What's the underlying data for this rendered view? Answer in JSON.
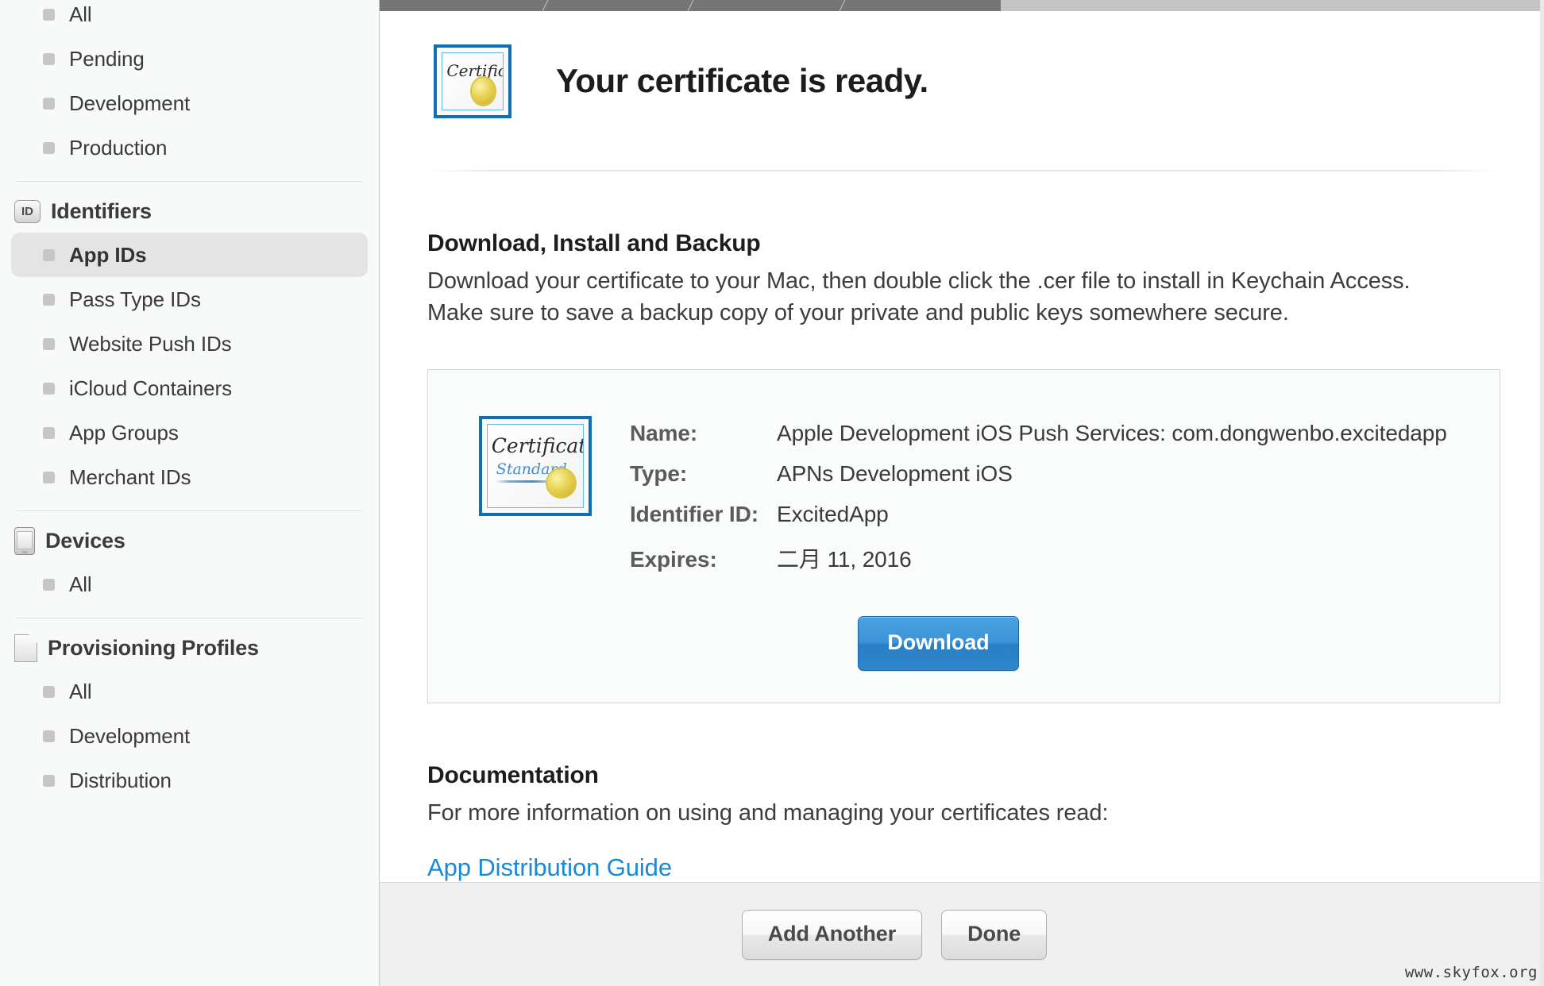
{
  "progress": {
    "completed_segments": 4,
    "track_color": "#c4c4c4",
    "done_color": "#757575"
  },
  "sidebar": {
    "groups": [
      {
        "header": null,
        "header_icon": null,
        "items": [
          {
            "label": "All",
            "selected": false
          },
          {
            "label": "Pending",
            "selected": false
          },
          {
            "label": "Development",
            "selected": false
          },
          {
            "label": "Production",
            "selected": false
          }
        ]
      },
      {
        "header": "Identifiers",
        "header_icon": "id-badge-icon",
        "header_icon_text": "ID",
        "items": [
          {
            "label": "App IDs",
            "selected": true
          },
          {
            "label": "Pass Type IDs",
            "selected": false
          },
          {
            "label": "Website Push IDs",
            "selected": false
          },
          {
            "label": "iCloud Containers",
            "selected": false
          },
          {
            "label": "App Groups",
            "selected": false
          },
          {
            "label": "Merchant IDs",
            "selected": false
          }
        ]
      },
      {
        "header": "Devices",
        "header_icon": "device-icon",
        "items": [
          {
            "label": "All",
            "selected": false
          }
        ]
      },
      {
        "header": "Provisioning Profiles",
        "header_icon": "document-icon",
        "items": [
          {
            "label": "All",
            "selected": false
          },
          {
            "label": "Development",
            "selected": false
          },
          {
            "label": "Distribution",
            "selected": false
          }
        ]
      }
    ]
  },
  "main": {
    "title": "Your certificate is ready.",
    "title_icon": "certificate-icon",
    "download_section": {
      "heading": "Download, Install and Backup",
      "body": "Download your certificate to your Mac, then double click the .cer file to install in Keychain Access. Make sure to save a backup copy of your private and public keys somewhere secure."
    },
    "certificate": {
      "icon": "certificate-standard-icon",
      "icon_word": "Certificate",
      "icon_word2": "Standard",
      "fields": [
        {
          "label": "Name:",
          "value": "Apple Development iOS Push Services: com.dongwenbo.excitedapp"
        },
        {
          "label": "Type:",
          "value": "APNs Development iOS"
        },
        {
          "label": "Identifier ID:",
          "value": "ExcitedApp"
        },
        {
          "label": "Expires:",
          "value": "二月 11, 2016"
        }
      ],
      "download_button": "Download",
      "download_button_color": "#2f86cb"
    },
    "documentation": {
      "heading": "Documentation",
      "body": "For more information on using and managing your certificates read:",
      "link": "App Distribution Guide",
      "link_color": "#1a89d6"
    }
  },
  "footer": {
    "add_another": "Add Another",
    "done": "Done"
  },
  "watermark": "www.skyfox.org"
}
